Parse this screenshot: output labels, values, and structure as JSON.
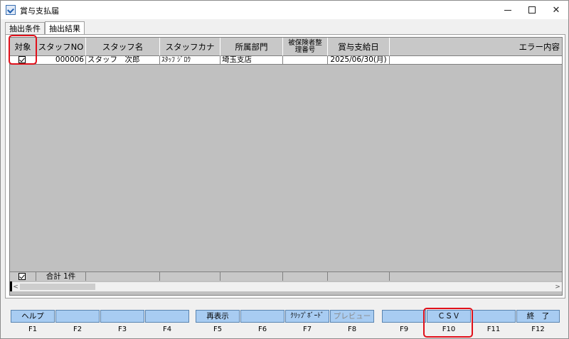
{
  "window": {
    "title": "賞与支払届",
    "controls": {
      "minimize": "minimize",
      "maximize": "maximize",
      "close": "✕"
    }
  },
  "tabs": [
    {
      "label": "抽出条件",
      "active": false
    },
    {
      "label": "抽出結果",
      "active": true
    }
  ],
  "grid": {
    "columns": [
      "対象",
      "スタッフNO",
      "スタッフ名",
      "スタッフカナ",
      "所属部門",
      "被保険者整\n理番号",
      "賞与支給日",
      "エラー内容"
    ],
    "rows": [
      {
        "checked": true,
        "staff_no": "000006",
        "staff_name": "スタッフ　次郎",
        "staff_kana": "ｽﾀｯﾌ ｼﾞﾛｳ",
        "department": "埼玉支店",
        "insured_no": "",
        "pay_date": "2025/06/30(月)",
        "error": ""
      }
    ],
    "footer": {
      "checked": true,
      "total": "合計 1件"
    },
    "scroll_left": "<",
    "scroll_right": ">"
  },
  "function_keys": [
    {
      "label": "ヘルプ",
      "key": "F1",
      "enabled": true
    },
    {
      "label": "",
      "key": "F2",
      "enabled": true
    },
    {
      "label": "",
      "key": "F3",
      "enabled": true
    },
    {
      "label": "",
      "key": "F4",
      "enabled": true
    },
    {
      "label": "再表示",
      "key": "F5",
      "enabled": true
    },
    {
      "label": "",
      "key": "F6",
      "enabled": true
    },
    {
      "label": "ｸﾘｯﾌﾟﾎﾞｰﾄﾞ",
      "key": "F7",
      "enabled": true
    },
    {
      "label": "プレビュー",
      "key": "F8",
      "enabled": false
    },
    {
      "label": "",
      "key": "F9",
      "enabled": true
    },
    {
      "label": "ＣＳＶ",
      "key": "F10",
      "enabled": true
    },
    {
      "label": "",
      "key": "F11",
      "enabled": true
    },
    {
      "label": "終　了",
      "key": "F12",
      "enabled": true
    }
  ],
  "colors": {
    "function_button": "#a8ccf2",
    "highlight": "#e0101a",
    "grid_background": "#c0c0c0"
  }
}
